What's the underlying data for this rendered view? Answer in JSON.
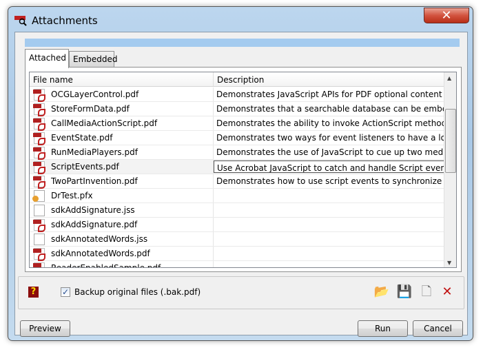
{
  "window": {
    "title": "Attachments",
    "close_label": "✕"
  },
  "tabs": [
    {
      "label": "Attached"
    },
    {
      "label": "Embedded"
    }
  ],
  "list": {
    "columns": [
      "File name",
      "Description"
    ],
    "rows": [
      {
        "name": "OCGLayerControl.pdf",
        "type": "pdf",
        "description": "Demonstrates JavaScript APIs for PDF optional content groups."
      },
      {
        "name": "StoreFormData.pdf",
        "type": "pdf",
        "description": "Demonstrates that a searchable database can be embedded  insi"
      },
      {
        "name": "CallMediaActionScript.pdf",
        "type": "pdf",
        "description": "Demonstrates the ability to invoke ActionScript methods embec"
      },
      {
        "name": "EventState.pdf",
        "type": "pdf",
        "description": "Demonstrates two ways for event listeners to have a local persist"
      },
      {
        "name": "RunMediaPlayers.pdf",
        "type": "pdf",
        "description": "Demonstrates the use of JavaScript to cue up two media players"
      },
      {
        "name": "ScriptEvents.pdf",
        "type": "pdf",
        "description": "Use Acrobat JavaScript to catch and handle Script events that th",
        "editing": true
      },
      {
        "name": "TwoPartInvention.pdf",
        "type": "pdf",
        "description": "Demonstrates how to use script events to synchronize UI and m"
      },
      {
        "name": "DrTest.pfx",
        "type": "pfx",
        "description": ""
      },
      {
        "name": "sdkAddSignature.jss",
        "type": "js",
        "description": ""
      },
      {
        "name": "sdkAddSignature.pdf",
        "type": "pdf",
        "description": ""
      },
      {
        "name": "sdkAnnotatedWords.jss",
        "type": "js",
        "description": ""
      },
      {
        "name": "sdkAnnotatedWords.pdf",
        "type": "pdf",
        "description": ""
      },
      {
        "name": "ReaderEnabledSample.pdf",
        "type": "pdf",
        "description": ""
      }
    ]
  },
  "options": {
    "backup_label": "Backup original files (.bak.pdf)",
    "backup_checked": true
  },
  "toolbar": {
    "icons": [
      "open-folder-icon",
      "save-attachment-icon",
      "new-file-icon",
      "delete-icon"
    ]
  },
  "buttons": {
    "preview": "Preview",
    "run": "Run",
    "cancel": "Cancel"
  }
}
